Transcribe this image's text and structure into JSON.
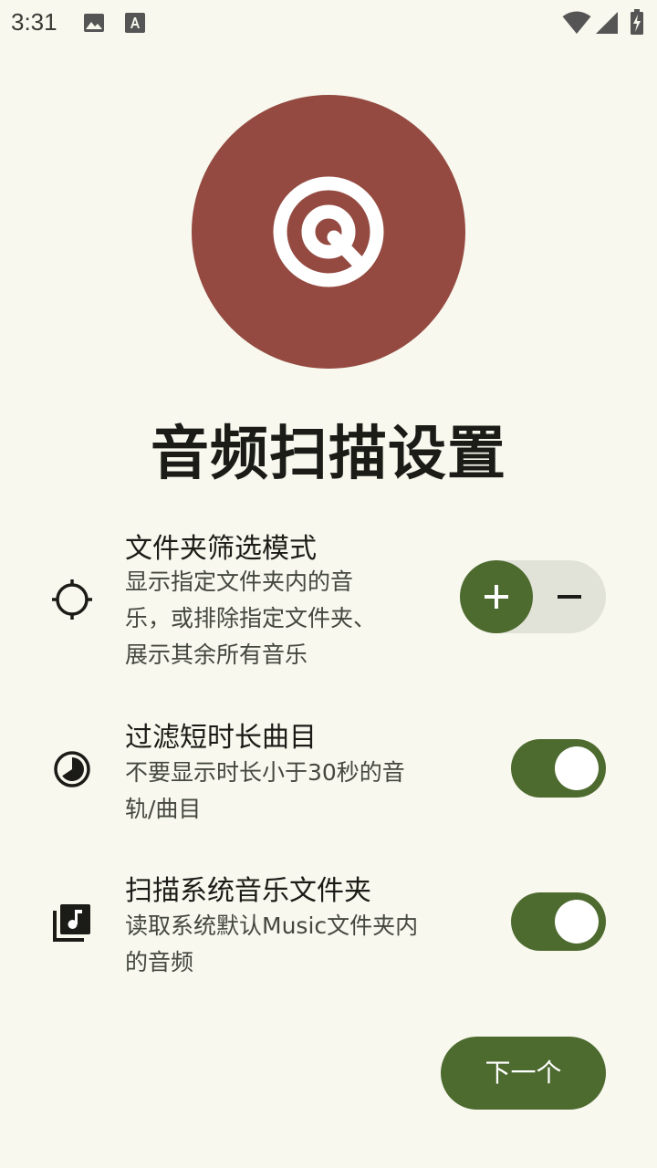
{
  "status_bar": {
    "time": "3:31"
  },
  "header": {
    "title": "音频扫描设置"
  },
  "settings": [
    {
      "title": "文件夹筛选模式",
      "desc": "显示指定文件夹内的音\n乐，或排除指定文件夹、\n展示其余所有音乐",
      "icon": "crosshair-icon",
      "control": "segmented",
      "selected": "include"
    },
    {
      "title": "过滤短时长曲目",
      "desc": "不要显示时长小于30秒的音\n轨/曲目",
      "icon": "timer-icon",
      "control": "switch",
      "checked": true
    },
    {
      "title": "扫描系统音乐文件夹",
      "desc": "读取系统默认Music文件夹内\n的音频",
      "icon": "library-music-icon",
      "control": "switch",
      "checked": true
    }
  ],
  "footer": {
    "next_label": "下一个"
  },
  "colors": {
    "background": "#f8f8ee",
    "hero": "#944a41",
    "accent": "#4d6a2f",
    "track_off": "#e2e3d8"
  }
}
